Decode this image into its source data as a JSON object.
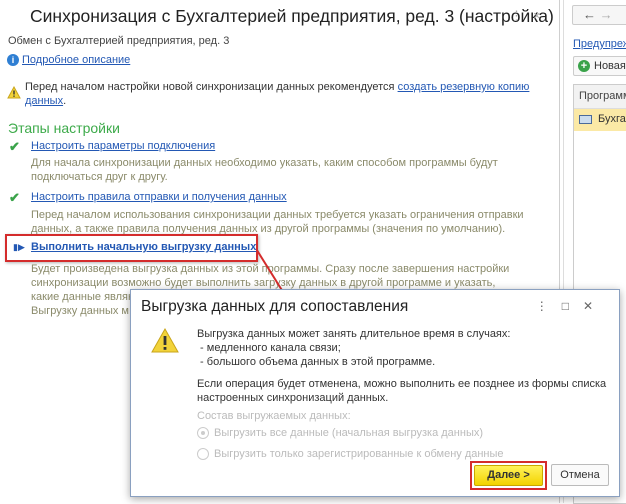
{
  "main": {
    "title": "Синхронизация с Бухгалтерией предприятия, ред. 3 (настройка)",
    "subtitle": "Обмен с Бухгалтерией предприятия, ред. 3",
    "info_link": "Подробное описание",
    "warning_text": "Перед началом настройки новой синхронизации данных рекомендуется ",
    "warning_link": "создать резервную копию данных",
    "warning_end": ".",
    "stages_title": "Этапы настройки",
    "steps": [
      {
        "link": "Настроить параметры подключения",
        "desc": "Для начала синхронизации данных необходимо указать, каким способом программы будут подключаться друг к другу."
      },
      {
        "link": "Настроить правила отправки и получения данных",
        "desc": "Перед началом использования синхронизации данных требуется указать ограничения отправки данных, а также правила получения данных из другой программы (значения по умолчанию)."
      },
      {
        "link": "Выполнить начальную выгрузку данных",
        "desc": "Будет произведена выгрузка данных из этой программы. Сразу после завершения настройки синхронизации возможно будет выполнить загрузку данных в другой программе и указать, какие данные являются од",
        "desc2": "Выгрузку данных м"
      }
    ]
  },
  "right": {
    "warn_link": "Предупреж",
    "new_button": "Новая",
    "column": "Программ",
    "row": "Бухга"
  },
  "dialog": {
    "title": "Выгрузка данных для сопоставления",
    "text1": "Выгрузка данных может занять длительное время в случаях:\n - медленного канала связи;\n - большого объема данных в этой программе.",
    "text2": "Если операция будет отменена, можно выполнить ее позднее из формы списка настроенных синхронизаций данных.",
    "composition_label": "Состав выгружаемых данных:",
    "option_all": "Выгрузить все данные (начальная выгрузка данных)",
    "option_registered": "Выгрузить только зарегистрированные к обмену данные",
    "next": "Далее >",
    "cancel": "Отмена"
  },
  "colors": {
    "accent": "#f3d300",
    "link": "#2358b4",
    "highlight": "#d42c2c",
    "stages": "#3daa4a"
  }
}
